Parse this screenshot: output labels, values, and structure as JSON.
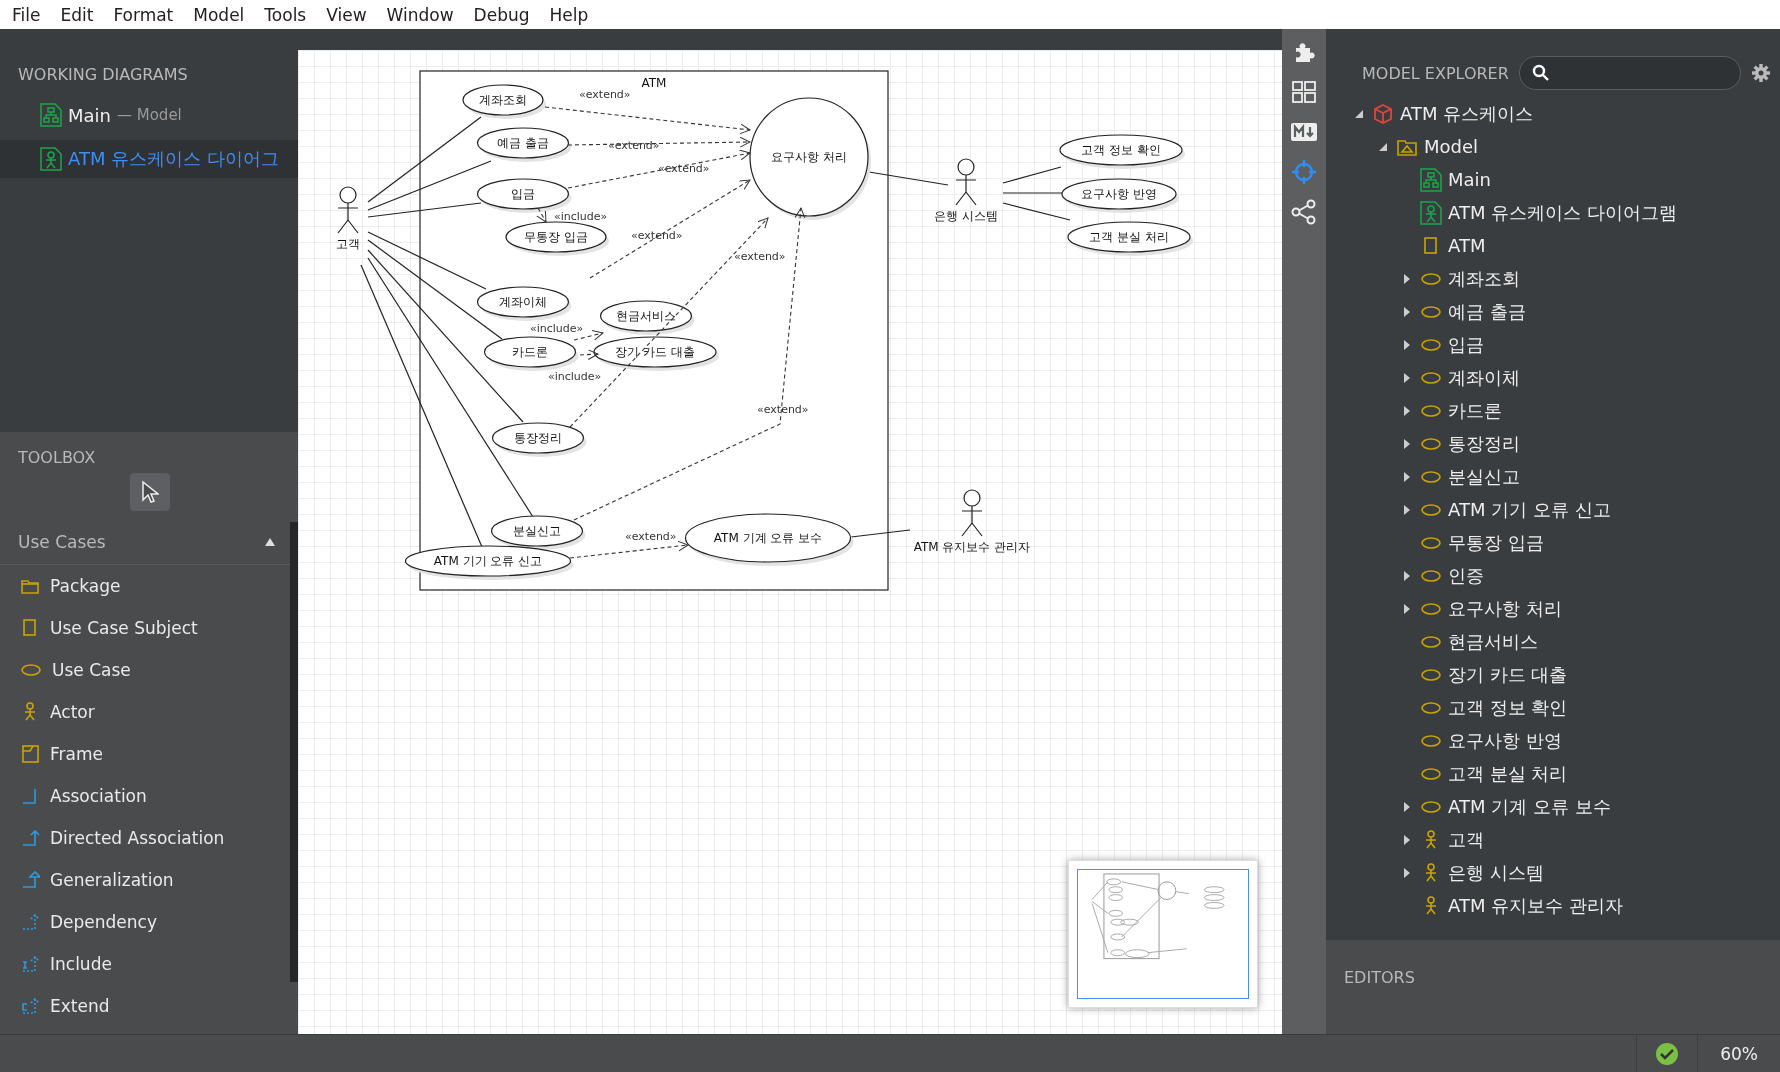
{
  "menu": [
    "File",
    "Edit",
    "Format",
    "Model",
    "Tools",
    "View",
    "Window",
    "Debug",
    "Help"
  ],
  "working_diagrams": {
    "title": "WORKING DIAGRAMS",
    "items": [
      {
        "name": "Main",
        "owner": "— Model",
        "kind": "class-diagram",
        "selected": false
      },
      {
        "name": "ATM 유스케이스 다이어그",
        "kind": "usecase-diagram",
        "selected": true
      }
    ]
  },
  "toolbox": {
    "title": "TOOLBOX",
    "group": "Use Cases",
    "group_expanded": true,
    "items": [
      {
        "label": "Package",
        "kind": "package"
      },
      {
        "label": "Use Case Subject",
        "kind": "subject"
      },
      {
        "label": "Use Case",
        "kind": "usecase"
      },
      {
        "label": "Actor",
        "kind": "actor"
      },
      {
        "label": "Frame",
        "kind": "frame"
      },
      {
        "label": "Association",
        "kind": "association"
      },
      {
        "label": "Directed Association",
        "kind": "directed"
      },
      {
        "label": "Generalization",
        "kind": "generalization"
      },
      {
        "label": "Dependency",
        "kind": "dependency"
      },
      {
        "label": "Include",
        "kind": "include"
      },
      {
        "label": "Extend",
        "kind": "extend"
      }
    ]
  },
  "diagram": {
    "frame": {
      "title": "ATM"
    },
    "use_cases": [
      {
        "name": "계좌조회"
      },
      {
        "name": "예금 출금"
      },
      {
        "name": "요구사항 처리"
      },
      {
        "name": "입금"
      },
      {
        "name": "무통장 입금"
      },
      {
        "name": "계좌이체"
      },
      {
        "name": "현금서비스"
      },
      {
        "name": "카드론"
      },
      {
        "name": "장기 카드 대출"
      },
      {
        "name": "통장정리"
      },
      {
        "name": "분실신고"
      },
      {
        "name": "ATM 기기 오류 신고"
      },
      {
        "name": "ATM 기계 오류 보수"
      },
      {
        "name": "고객 정보 확인"
      },
      {
        "name": "요구사항 반영"
      },
      {
        "name": "고객 분실 처리"
      }
    ],
    "actors": [
      {
        "name": "고객"
      },
      {
        "name": "은행 시스템"
      },
      {
        "name": "ATM 유지보수 관리자"
      }
    ],
    "relations": [
      {
        "label": "«extend»"
      },
      {
        "label": "«extend»"
      },
      {
        "label": "«extend»"
      },
      {
        "label": "«include»"
      },
      {
        "label": "«extend»"
      },
      {
        "label": "«extend»"
      },
      {
        "label": "«include»"
      },
      {
        "label": "«include»"
      },
      {
        "label": "«extend»"
      },
      {
        "label": "«extend»"
      }
    ]
  },
  "model_explorer": {
    "title": "MODEL EXPLORER",
    "tree": [
      {
        "name": "ATM 유스케이스",
        "kind": "project",
        "expandable": true,
        "expanded": true,
        "children": [
          {
            "name": "Model",
            "kind": "model",
            "expandable": true,
            "expanded": true,
            "children": [
              {
                "name": "Main",
                "kind": "class-diagram",
                "expandable": false
              },
              {
                "name": "ATM 유스케이스 다이어그램",
                "kind": "usecase-diagram",
                "expandable": false
              },
              {
                "name": "ATM",
                "kind": "subject",
                "expandable": false
              },
              {
                "name": "계좌조회",
                "kind": "usecase",
                "expandable": true,
                "expanded": false
              },
              {
                "name": "예금 출금",
                "kind": "usecase",
                "expandable": true,
                "expanded": false
              },
              {
                "name": "입금",
                "kind": "usecase",
                "expandable": true,
                "expanded": false
              },
              {
                "name": "계좌이체",
                "kind": "usecase",
                "expandable": true,
                "expanded": false
              },
              {
                "name": "카드론",
                "kind": "usecase",
                "expandable": true,
                "expanded": false
              },
              {
                "name": "통장정리",
                "kind": "usecase",
                "expandable": true,
                "expanded": false
              },
              {
                "name": "분실신고",
                "kind": "usecase",
                "expandable": true,
                "expanded": false
              },
              {
                "name": "ATM 기기 오류 신고",
                "kind": "usecase",
                "expandable": true,
                "expanded": false
              },
              {
                "name": "무통장 입금",
                "kind": "usecase",
                "expandable": false
              },
              {
                "name": "인증",
                "kind": "usecase",
                "expandable": true,
                "expanded": false
              },
              {
                "name": "요구사항 처리",
                "kind": "usecase",
                "expandable": true,
                "expanded": false
              },
              {
                "name": "현금서비스",
                "kind": "usecase",
                "expandable": false
              },
              {
                "name": "장기 카드 대출",
                "kind": "usecase",
                "expandable": false
              },
              {
                "name": "고객 정보 확인",
                "kind": "usecase",
                "expandable": false
              },
              {
                "name": "요구사항 반영",
                "kind": "usecase",
                "expandable": false
              },
              {
                "name": "고객 분실 처리",
                "kind": "usecase",
                "expandable": false
              },
              {
                "name": "ATM 기계 오류 보수",
                "kind": "usecase",
                "expandable": true,
                "expanded": false
              },
              {
                "name": "고객",
                "kind": "actor",
                "expandable": true,
                "expanded": false
              },
              {
                "name": "은행 시스템",
                "kind": "actor",
                "expandable": true,
                "expanded": false
              },
              {
                "name": "ATM 유지보수 관리자",
                "kind": "actor",
                "expandable": false
              }
            ]
          }
        ]
      }
    ]
  },
  "editors": {
    "title": "EDITORS"
  },
  "status_bar": {
    "valid": true,
    "zoom": "60%"
  }
}
